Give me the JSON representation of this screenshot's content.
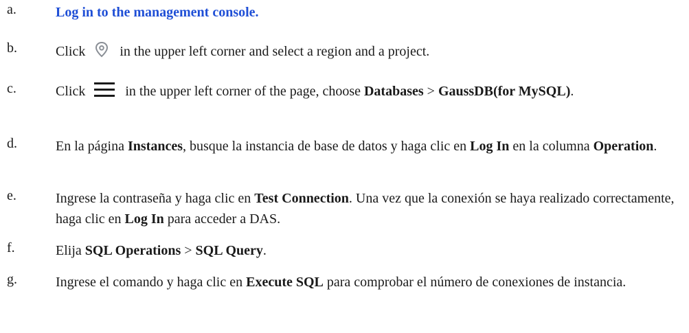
{
  "steps": [
    {
      "marker": "a.",
      "link": "Log in to the management console."
    },
    {
      "marker": "b.",
      "prefix": "Click",
      "icon": "location-pin-icon",
      "suffix": "in the upper left corner and select a region and a project."
    },
    {
      "marker": "c.",
      "prefix": "Click",
      "icon": "hamburger-menu-icon",
      "text1": "in the upper left corner of the page, choose ",
      "bold1": "Databases",
      "text2": " > ",
      "bold2": "GaussDB(for MySQL)",
      "text3": "."
    },
    {
      "marker": "d.",
      "text1": "En la página ",
      "bold1": "Instances",
      "text2": ", busque la instancia de base de datos y haga clic en ",
      "bold2": "Log In",
      "text3": " en la columna ",
      "bold3": "Operation",
      "text4": "."
    },
    {
      "marker": "e.",
      "text1": "Ingrese la contraseña y haga clic en ",
      "bold1": "Test Connection",
      "text2": ". Una vez que la conexión se haya realizado correctamente, haga clic en ",
      "bold2": "Log In",
      "text3": " para acceder a DAS."
    },
    {
      "marker": "f.",
      "text1": "Elija ",
      "bold1": "SQL Operations",
      "text2": " > ",
      "bold2": "SQL Query",
      "text3": "."
    },
    {
      "marker": "g.",
      "text1": "Ingrese el comando y haga clic en ",
      "bold1": "Execute SQL",
      "text2": " para comprobar el número de conexiones de instancia."
    }
  ]
}
